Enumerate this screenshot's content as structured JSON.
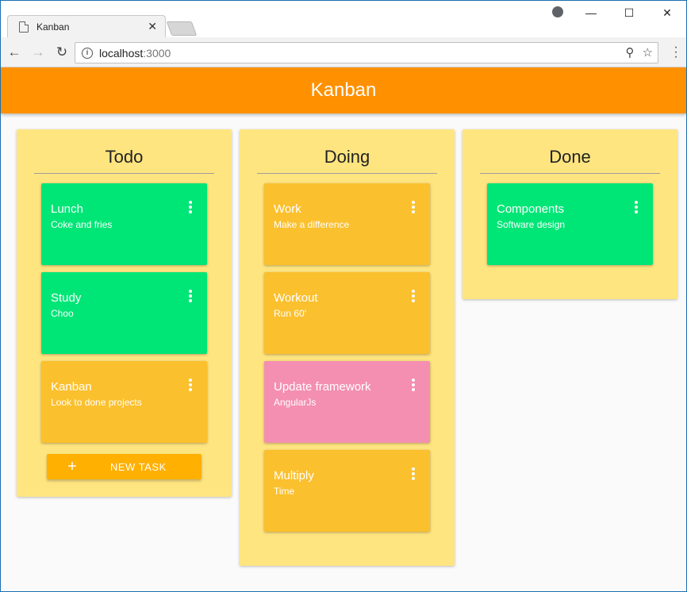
{
  "browser": {
    "tab_title": "Kanban",
    "tab_close": "✕",
    "url_host": "localhost",
    "url_port": ":3000",
    "window_controls": [
      "—",
      "☐",
      "✕"
    ]
  },
  "app": {
    "title": "Kanban",
    "new_task_label": "NEW TASK",
    "new_task_plus": "+"
  },
  "colors": {
    "appbar": "#ff9000",
    "column": "#ffe580",
    "green": "#00e676",
    "amber": "#fbc02d",
    "pink": "#f48fb1",
    "button": "#ffb000"
  },
  "columns": [
    {
      "name": "Todo",
      "cards": [
        {
          "title": "Lunch",
          "desc": "Coke and fries",
          "color": "#00e676"
        },
        {
          "title": "Study",
          "desc": "Choo",
          "color": "#00e676"
        },
        {
          "title": "Kanban",
          "desc": "Look to done projects",
          "color": "#fbc02d"
        }
      ]
    },
    {
      "name": "Doing",
      "cards": [
        {
          "title": "Work",
          "desc": "Make a difference",
          "color": "#fbc02d"
        },
        {
          "title": "Workout",
          "desc": "Run 60'",
          "color": "#fbc02d"
        },
        {
          "title": "Update framework",
          "desc": "AngularJs",
          "color": "#f48fb1"
        },
        {
          "title": "Multiply",
          "desc": "Time",
          "color": "#fbc02d"
        }
      ]
    },
    {
      "name": "Done",
      "cards": [
        {
          "title": "Components",
          "desc": "Software design",
          "color": "#00e676"
        }
      ]
    }
  ]
}
